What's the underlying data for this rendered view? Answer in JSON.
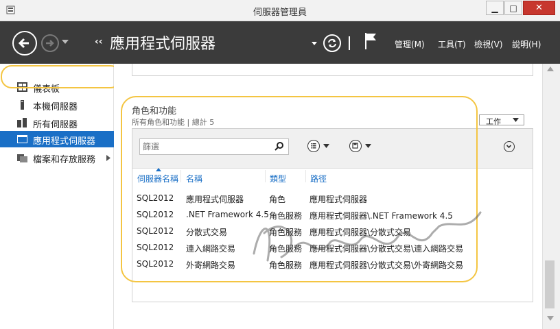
{
  "window": {
    "title": "伺服器管理員",
    "minimize": "▁",
    "maximize": "□",
    "close": "✕"
  },
  "header": {
    "breadcrumb_arrows": "‹‹",
    "title": "應用程式伺服器",
    "menu": [
      "管理(M)",
      "工具(T)",
      "檢視(V)",
      "說明(H)"
    ]
  },
  "sidebar": {
    "items": [
      {
        "label": "儀表板",
        "icon": "dashboard-icon"
      },
      {
        "label": "本機伺服器",
        "icon": "server-icon"
      },
      {
        "label": "所有伺服器",
        "icon": "servers-icon"
      },
      {
        "label": "應用程式伺服器",
        "icon": "app-server-icon",
        "active": true
      },
      {
        "label": "檔案和存放服務",
        "icon": "file-storage-icon",
        "expandable": true
      }
    ]
  },
  "roles": {
    "title": "角色和功能",
    "subtitle": "所有角色和功能 | 總計 5",
    "tasks_label": "工作",
    "filter_placeholder": "篩選",
    "columns": [
      "伺服器名稱",
      "名稱",
      "類型",
      "路徑"
    ],
    "rows": [
      [
        "SQL2012",
        "應用程式伺服器",
        "角色",
        "應用程式伺服器"
      ],
      [
        "SQL2012",
        ".NET Framework 4.5",
        "角色服務",
        "應用程式伺服器\\.NET Framework 4.5"
      ],
      [
        "SQL2012",
        "分散式交易",
        "角色服務",
        "應用程式伺服器\\分散式交易"
      ],
      [
        "SQL2012",
        "連入網路交易",
        "角色服務",
        "應用程式伺服器\\分散式交易\\連入網路交易"
      ],
      [
        "SQL2012",
        "外寄網路交易",
        "角色服務",
        "應用程式伺服器\\分散式交易\\外寄網路交易"
      ]
    ]
  },
  "colors": {
    "header_bg": "#3b3b3b",
    "active_item": "#1a6fc6",
    "highlight": "#f4c542",
    "link": "#1a6fc6"
  }
}
